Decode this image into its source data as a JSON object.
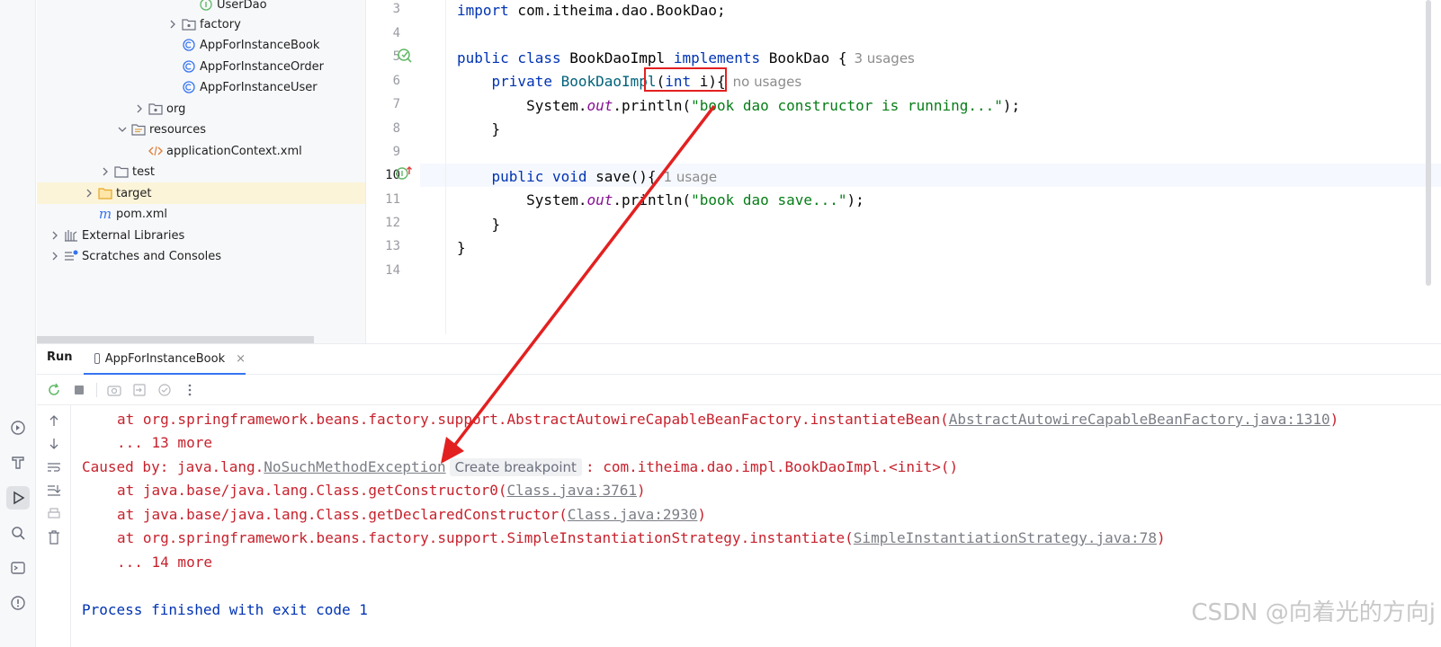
{
  "tree": {
    "items": [
      {
        "label": "UserDao",
        "icon": "interface-icon"
      },
      {
        "label": "factory",
        "icon": "package-icon"
      },
      {
        "label": "AppForInstanceBook",
        "icon": "class-run-icon"
      },
      {
        "label": "AppForInstanceOrder",
        "icon": "class-run-icon"
      },
      {
        "label": "AppForInstanceUser",
        "icon": "class-run-icon"
      },
      {
        "label": "org",
        "icon": "package-icon"
      },
      {
        "label": "resources",
        "icon": "resources-folder-icon"
      },
      {
        "label": "applicationContext.xml",
        "icon": "xml-icon"
      },
      {
        "label": "test",
        "icon": "folder-icon"
      },
      {
        "label": "target",
        "icon": "folder-icon"
      },
      {
        "label": "pom.xml",
        "icon": "maven-icon"
      },
      {
        "label": "External Libraries",
        "icon": "library-icon"
      },
      {
        "label": "Scratches and Consoles",
        "icon": "scratches-icon"
      }
    ]
  },
  "editor": {
    "line_numbers": [
      "3",
      "4",
      "5",
      "6",
      "7",
      "8",
      "9",
      "10",
      "11",
      "12",
      "13",
      "14"
    ],
    "lines": {
      "l3_kw": "import",
      "l3_rest": " com.itheima.dao.BookDao;",
      "l5_kw1": "public class",
      "l5_cls": " BookDaoImpl ",
      "l5_kw2": "implements",
      "l5_rest": " BookDao {",
      "l5_hint": "3 usages",
      "l6_kw": "    private",
      "l6_ctor": " BookDaoImpl",
      "l6_paren": "(",
      "l6_kw2": "int",
      "l6_rest": " i){",
      "l6_hint": "no usages",
      "l7_pre": "        System.",
      "l7_fld": "out",
      "l7_mid": ".println(",
      "l7_str": "\"book dao constructor is running...\"",
      "l7_end": ");",
      "l8": "    }",
      "l10_kw": "    public void",
      "l10_rest": " save(){",
      "l10_hint": "1 usage",
      "l11_pre": "        System.",
      "l11_fld": "out",
      "l11_mid": ".println(",
      "l11_str": "\"book dao save...\"",
      "l11_end": ");",
      "l12": "    }",
      "l13": "}"
    }
  },
  "run": {
    "title": "Run",
    "tab_label": "AppForInstanceBook",
    "close_glyph": "×",
    "console": {
      "c1_pre": "at org.springframework.beans.factory.support.AbstractAutowireCapableBeanFactory.instantiateBean(",
      "c1_link": "AbstractAutowireCapableBeanFactory.java:1310",
      "c1_end": ")",
      "c2": "... 13 more",
      "c3_pre": "Caused by: java.lang.",
      "c3_link": "NoSuchMethodException",
      "c3_chip": "Create breakpoint",
      "c3_end": ": com.itheima.dao.impl.BookDaoImpl.<init>()",
      "c4_pre": "at java.base/java.lang.Class.getConstructor0(",
      "c4_link": "Class.java:3761",
      "c4_end": ")",
      "c5_pre": "at java.base/java.lang.Class.getDeclaredConstructor(",
      "c5_link": "Class.java:2930",
      "c5_end": ")",
      "c6_pre": "at org.springframework.beans.factory.support.SimpleInstantiationStrategy.instantiate(",
      "c6_link": "SimpleInstantiationStrategy.java:78",
      "c6_end": ")",
      "c7": "... 14 more",
      "c8": "Process finished with exit code 1"
    }
  },
  "watermark": "CSDN @向着光的方向j",
  "colors": {
    "annotation_red": "#e32020",
    "accent": "#3574f0",
    "error_text": "#c7222d"
  }
}
